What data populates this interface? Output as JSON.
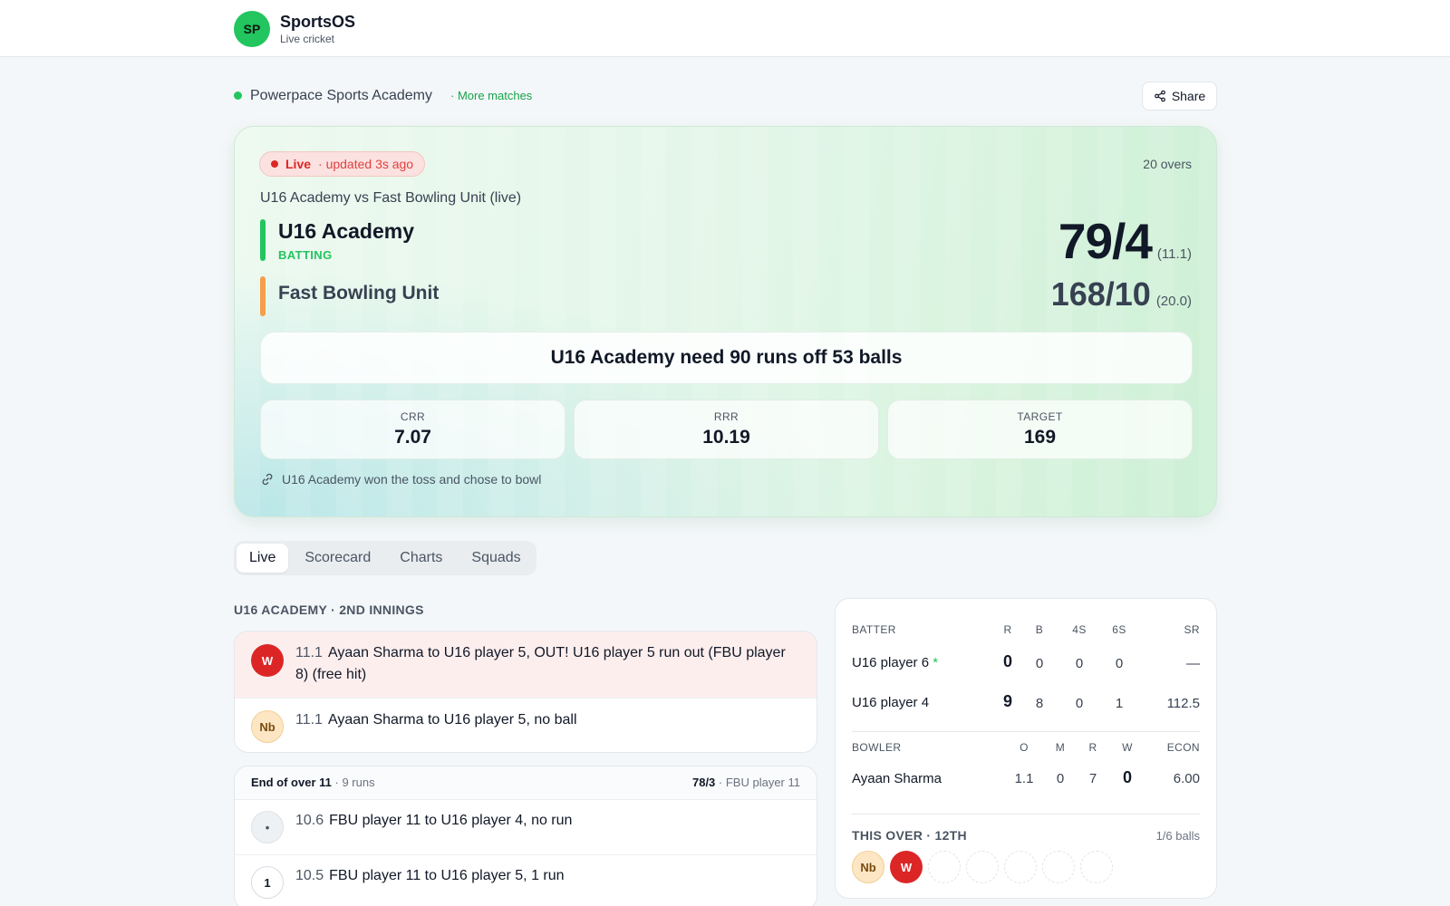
{
  "brand": {
    "logo_initials": "SP",
    "name": "SportsOS",
    "subtitle": "Live cricket"
  },
  "org": {
    "name": "Powerpace Sports Academy",
    "more_link": "· More matches",
    "share_label": "Share"
  },
  "match": {
    "live_label": "Live",
    "updated": "· updated 3s ago",
    "overs_total": "20 overs",
    "title": "U16 Academy vs Fast Bowling Unit (live)",
    "team1": {
      "name": "U16 Academy",
      "status": "BATTING",
      "score": "79/4",
      "overs": "(11.1)"
    },
    "team2": {
      "name": "Fast Bowling Unit",
      "score": "168/10",
      "overs": "(20.0)"
    },
    "equation": "U16 Academy need 90 runs off 53 balls",
    "stats": [
      {
        "label": "CRR",
        "value": "7.07"
      },
      {
        "label": "RRR",
        "value": "10.19"
      },
      {
        "label": "TARGET",
        "value": "169"
      }
    ],
    "toss": "U16 Academy won the toss and chose to bowl"
  },
  "tabs": [
    "Live",
    "Scorecard",
    "Charts",
    "Squads"
  ],
  "commentary": {
    "innings_label": "U16 ACADEMY · 2ND INNINGS",
    "balls_a": [
      {
        "badge": "W",
        "over": "11.1",
        "text": "Ayaan Sharma to U16 player 5, OUT! U16 player 5 run out (FBU player 8) (free hit)"
      },
      {
        "badge": "Nb",
        "over": "11.1",
        "text": "Ayaan Sharma to U16 player 5, no ball"
      }
    ],
    "over_end": {
      "title": "End of over 11",
      "runs": "· 9 runs",
      "score": "78/3",
      "bowler": "· FBU player 11"
    },
    "balls_b": [
      {
        "badge": "•",
        "over": "10.6",
        "text": "FBU player 11 to U16 player 4, no run"
      },
      {
        "badge": "1",
        "over": "10.5",
        "text": "FBU player 11 to U16 player 5, 1 run"
      }
    ]
  },
  "batting": {
    "headers": [
      "BATTER",
      "R",
      "B",
      "4S",
      "6S",
      "SR"
    ],
    "rows": [
      {
        "name": "U16 player 6",
        "star": "*",
        "r": "0",
        "b": "0",
        "fours": "0",
        "sixes": "0",
        "sr": "—"
      },
      {
        "name": "U16 player 4",
        "star": "",
        "r": "9",
        "b": "8",
        "fours": "0",
        "sixes": "1",
        "sr": "112.5"
      }
    ]
  },
  "bowling": {
    "headers": [
      "BOWLER",
      "O",
      "M",
      "R",
      "W",
      "ECON"
    ],
    "rows": [
      {
        "name": "Ayaan Sharma",
        "o": "1.1",
        "m": "0",
        "r": "7",
        "w": "0",
        "econ": "6.00"
      }
    ]
  },
  "this_over": {
    "label": "THIS OVER · 12TH",
    "balls_count": "1/6 balls",
    "balls": [
      "Nb",
      "W"
    ]
  },
  "colors": {
    "accent": "#22c55e",
    "wicket": "#dc2626",
    "team2": "#f59e4b"
  }
}
